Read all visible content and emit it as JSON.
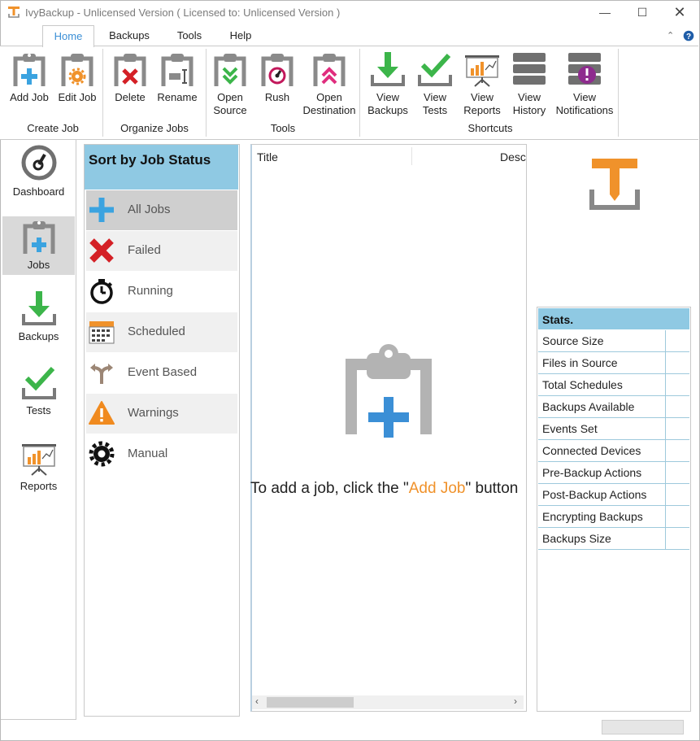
{
  "window": {
    "title": "IvyBackup - Unlicensed Version ( Licensed to: Unlicensed Version )"
  },
  "menu": {
    "tabs": [
      {
        "label": "Home"
      },
      {
        "label": "Backups"
      },
      {
        "label": "Tools"
      },
      {
        "label": "Help"
      }
    ]
  },
  "ribbon": {
    "groups": {
      "create_job": "Create Job",
      "organize_jobs": "Organize Jobs",
      "tools": "Tools",
      "shortcuts": "Shortcuts"
    },
    "buttons": {
      "add_job": "Add Job",
      "edit_job": "Edit Job",
      "delete": "Delete",
      "rename": "Rename",
      "open_source_1": "Open",
      "open_source_2": "Source",
      "rush": "Rush",
      "open_dest_1": "Open",
      "open_dest_2": "Destination",
      "view_backups_1": "View",
      "view_backups_2": "Backups",
      "view_tests_1": "View",
      "view_tests_2": "Tests",
      "view_reports_1": "View",
      "view_reports_2": "Reports",
      "view_history_1": "View",
      "view_history_2": "History",
      "view_notifications_1": "View",
      "view_notifications_2": "Notifications"
    }
  },
  "nav": {
    "dashboard": "Dashboard",
    "jobs": "Jobs",
    "backups": "Backups",
    "tests": "Tests",
    "reports": "Reports"
  },
  "status_filter": {
    "header": "Sort by Job Status",
    "items": [
      {
        "label": "All Jobs"
      },
      {
        "label": "Failed"
      },
      {
        "label": "Running"
      },
      {
        "label": "Scheduled"
      },
      {
        "label": "Event Based"
      },
      {
        "label": "Warnings"
      },
      {
        "label": "Manual"
      }
    ]
  },
  "job_list": {
    "columns": {
      "title": "Title",
      "description": "Desc"
    },
    "empty_prefix": "To add a job, click the \"",
    "empty_link": "Add Job",
    "empty_suffix": "\" button"
  },
  "stats": {
    "header": "Stats.",
    "rows": [
      {
        "label": "Source Size",
        "value": ""
      },
      {
        "label": "Files in Source",
        "value": ""
      },
      {
        "label": "Total Schedules",
        "value": ""
      },
      {
        "label": "Backups Available",
        "value": ""
      },
      {
        "label": "Events Set",
        "value": ""
      },
      {
        "label": "Connected Devices",
        "value": ""
      },
      {
        "label": "Pre-Backup Actions",
        "value": ""
      },
      {
        "label": "Post-Backup Actions",
        "value": ""
      },
      {
        "label": "Encrypting Backups",
        "value": ""
      },
      {
        "label": "Backups Size",
        "value": ""
      }
    ]
  },
  "colors": {
    "accent_blue": "#3b8fd6",
    "header_blue": "#8fc9e3",
    "orange": "#f0922b",
    "green": "#3cb54a",
    "red": "#d42026",
    "gray_icon": "#707070"
  }
}
